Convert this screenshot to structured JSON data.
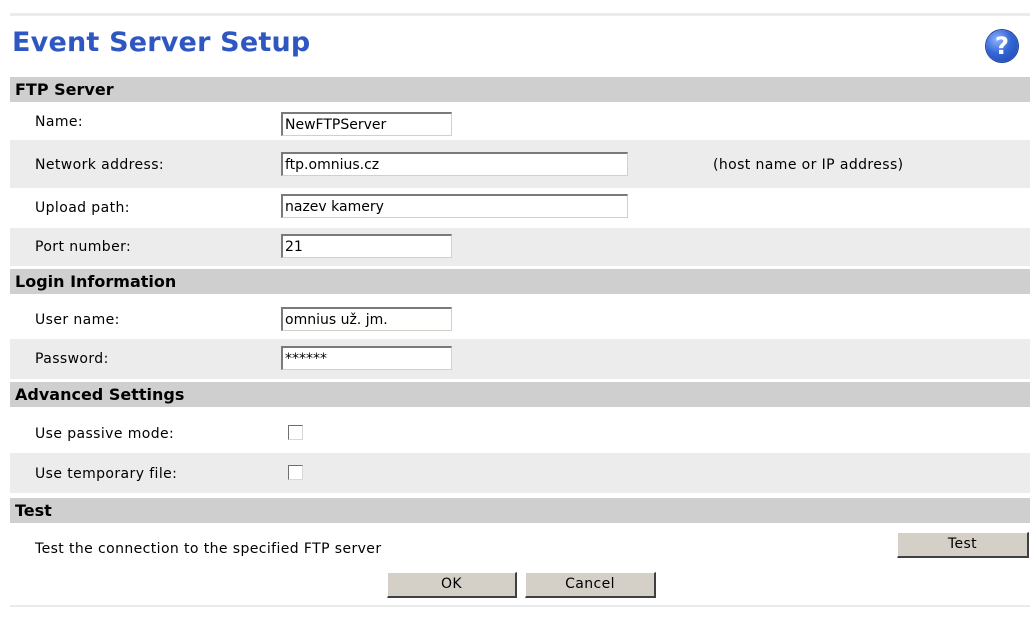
{
  "page": {
    "title": "Event Server Setup",
    "help_icon": "question-mark-icon"
  },
  "ftp_server": {
    "heading": "FTP Server",
    "name_label": "Name:",
    "name_value": "NewFTPServer",
    "address_label": "Network address:",
    "address_value": "ftp.omnius.cz",
    "address_hint": "(host name or IP address)",
    "path_label": "Upload path:",
    "path_value": "nazev kamery",
    "port_label": "Port number:",
    "port_value": "21"
  },
  "login": {
    "heading": "Login Information",
    "user_label": "User name:",
    "user_value": "omnius už. jm.",
    "password_label": "Password:",
    "password_value": "******"
  },
  "advanced": {
    "heading": "Advanced Settings",
    "passive_label": "Use passive mode:",
    "passive_checked": false,
    "tempfile_label": "Use temporary file:",
    "tempfile_checked": false
  },
  "test": {
    "heading": "Test",
    "description": "Test the connection to the specified FTP server",
    "button_label": "Test"
  },
  "actions": {
    "ok_label": "OK",
    "cancel_label": "Cancel"
  },
  "colors": {
    "title": "#2f57c2",
    "section_header": "#cfcfcf",
    "row_alt": "#ececec",
    "button_face": "#d4d0c8"
  }
}
